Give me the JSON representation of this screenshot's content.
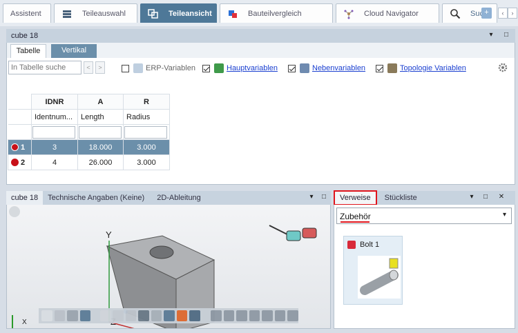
{
  "top_tabs": [
    {
      "label": "Assistent",
      "icon": "none"
    },
    {
      "label": "Teileauswahl",
      "icon": "books-icon"
    },
    {
      "label": "Teileansicht",
      "icon": "parts-view-icon"
    },
    {
      "label": "Bauteilvergleich",
      "icon": "compare-icon"
    },
    {
      "label": "Cloud Navigator",
      "icon": "network-icon"
    },
    {
      "label": "Suche",
      "icon": "search-icon"
    }
  ],
  "top_nav": {
    "prev": "‹",
    "next": "›"
  },
  "search_overlay_text": "+",
  "table_panel": {
    "title": "cube 18",
    "tabs": [
      "Tabelle",
      "Vertikal"
    ],
    "search_placeholder": "In Tabelle suche",
    "nav_prev": "<",
    "nav_next": ">",
    "filters": [
      {
        "label": "ERP-Variablen",
        "checked": false,
        "link": false
      },
      {
        "label": "Hauptvariablen",
        "checked": true,
        "link": true
      },
      {
        "label": "Nebenvariablen",
        "checked": true,
        "link": true
      },
      {
        "label": "Topologie Variablen",
        "checked": true,
        "link": true
      }
    ],
    "columns": [
      {
        "name": "IDNR",
        "desc": "Identnum..."
      },
      {
        "name": "A",
        "desc": "Length"
      },
      {
        "name": "R",
        "desc": "Radius"
      }
    ],
    "rows": [
      {
        "num": "1",
        "cells": [
          "3",
          "18.000",
          "3.000"
        ],
        "selected": true
      },
      {
        "num": "2",
        "cells": [
          "4",
          "26.000",
          "3.000"
        ],
        "selected": false
      }
    ]
  },
  "viewer_panel": {
    "tabs": [
      "cube 18",
      "Technische Angaben (Keine)",
      "2D-Ableitung"
    ],
    "axes": {
      "y": "Y",
      "z": "Z",
      "x": "X"
    }
  },
  "right_panel": {
    "tabs": [
      "Verweise",
      "Stückliste"
    ],
    "dropdown_value": "Zubehör",
    "item_label": "Bolt 1"
  },
  "colors": {
    "accent": "#4e7898",
    "selected_row": "#6b8faa",
    "highlight_red": "#d8101a"
  }
}
